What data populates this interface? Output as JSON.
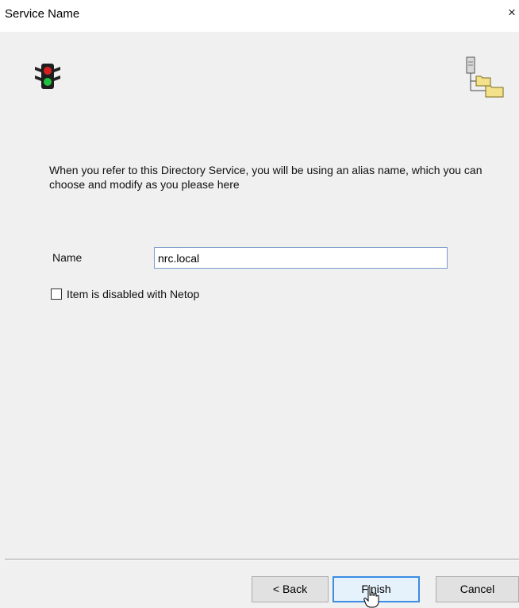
{
  "window": {
    "title": "Service Name",
    "close_glyph": "×"
  },
  "icons": {
    "left": "traffic-light-icon",
    "right": "directory-tree-icon",
    "colors": {
      "light_red": "#d62020",
      "light_green": "#20c040",
      "folder_yellow": "#f3e28a"
    }
  },
  "description": "When you refer to this Directory Service, you will be using an alias name, which you can choose and modify as you please here",
  "form": {
    "name_label": "Name",
    "name_value": "nrc.local",
    "checkbox_label": "Item is disabled with Netop",
    "checkbox_checked": false
  },
  "buttons": {
    "back": "< Back",
    "finish": "Finish",
    "cancel": "Cancel"
  }
}
